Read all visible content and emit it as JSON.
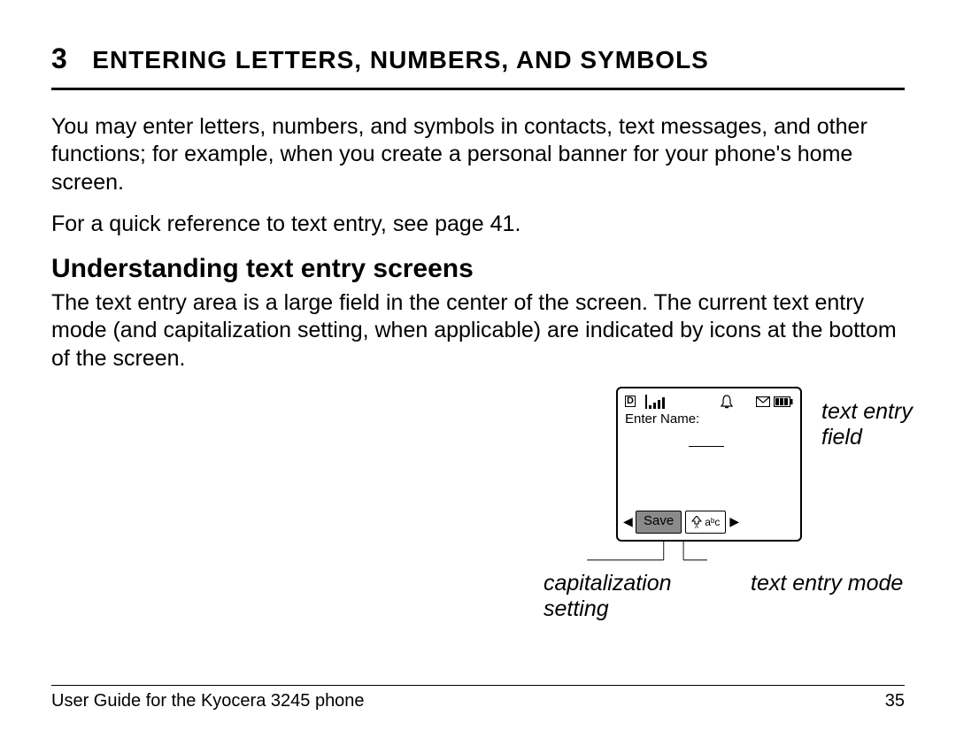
{
  "chapter": {
    "number": "3",
    "title": "ENTERING LETTERS, NUMBERS, AND SYMBOLS"
  },
  "paragraphs": {
    "p1": "You may enter letters, numbers, and symbols in contacts, text messages, and other functions; for example, when you create a personal banner for your phone's home screen.",
    "p2": "For a quick reference to text entry, see page 41."
  },
  "subhead": "Understanding text entry screens",
  "paragraphs2": {
    "p3": "The text entry area is a large field in the center of the screen. The current text entry mode (and capitalization setting, when applicable) are indicated by icons at the bottom of the screen."
  },
  "diagram": {
    "status_d": "D",
    "enter_name_label": "Enter Name:",
    "save_label": "Save",
    "abc_label": "aᵇc",
    "left_arrow": "◀",
    "right_arrow": "▶"
  },
  "callouts": {
    "text_entry_field": "text entry field",
    "capitalization": "capitalization setting",
    "mode": "text entry mode"
  },
  "footer": {
    "left": "User Guide for the Kyocera 3245 phone",
    "page": "35"
  }
}
